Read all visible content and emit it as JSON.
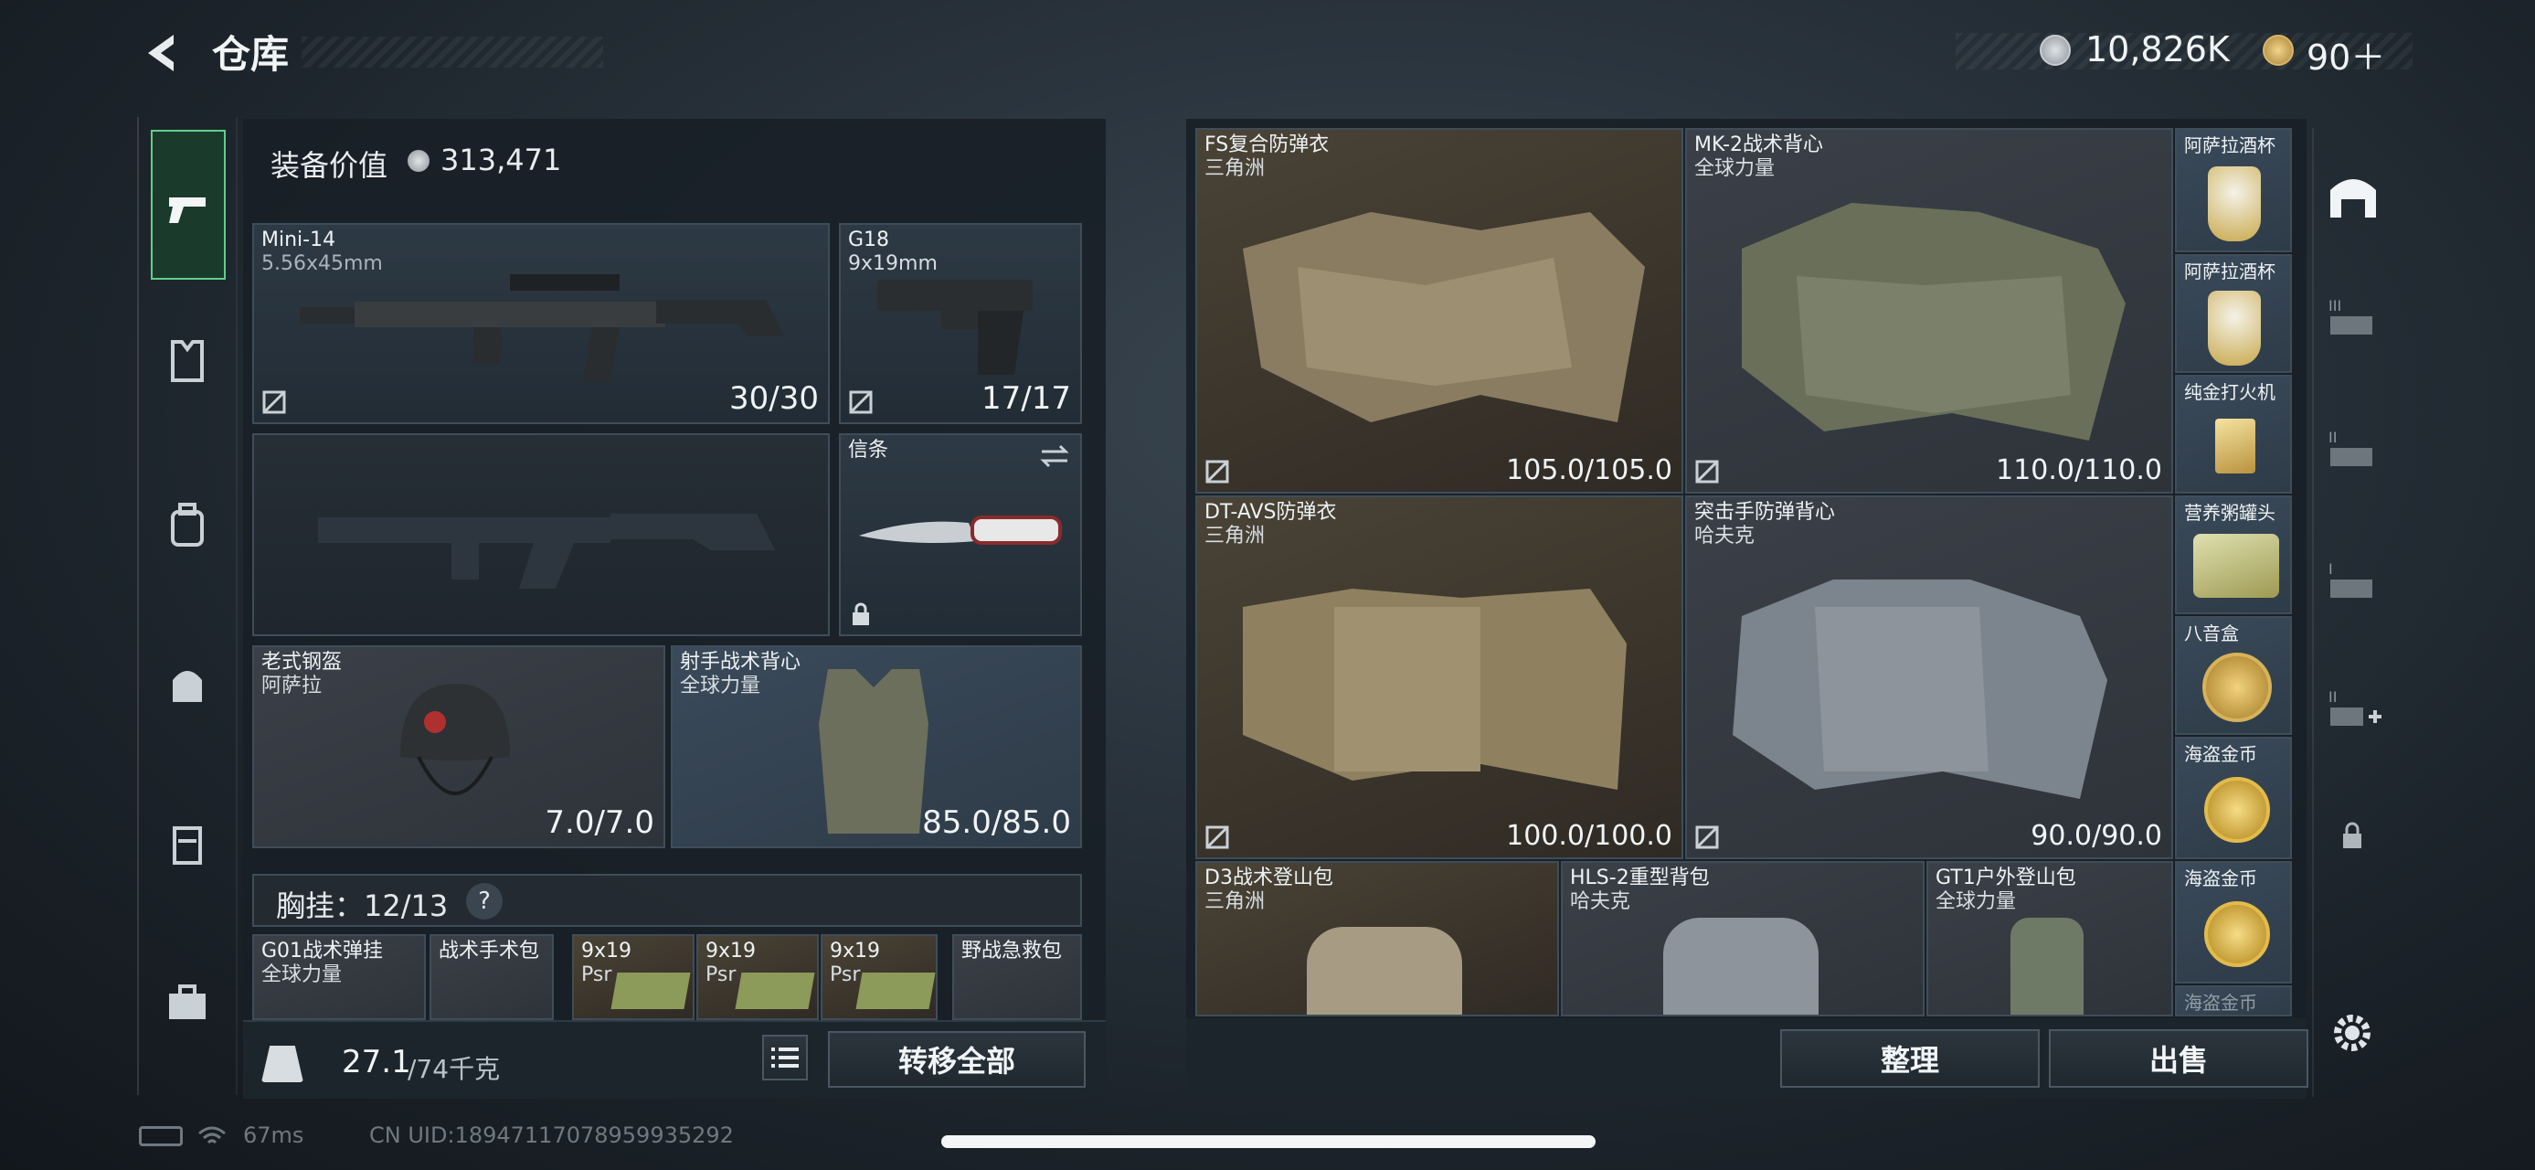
{
  "header": {
    "title": "仓库",
    "currency1": "10,826K",
    "currency2": "90＋"
  },
  "equip_value": {
    "label": "装备价值",
    "value": "313,471"
  },
  "weapons": [
    {
      "name": "Mini-14",
      "ammo": "5.56x45mm",
      "count": "30/30"
    },
    {
      "name": "G18",
      "ammo": "9x19mm",
      "count": "17/17"
    }
  ],
  "melee": {
    "name": "信条"
  },
  "helmet": {
    "name": "老式钢盔",
    "origin": "阿萨拉",
    "durability": "7.0/7.0"
  },
  "vest": {
    "name": "射手战术背心",
    "origin": "全球力量",
    "durability": "85.0/85.0"
  },
  "chest_rig": {
    "label": "胸挂：12/13",
    "help": "?"
  },
  "rig_items": [
    {
      "name": "G01战术弹挂",
      "sub": "全球力量"
    },
    {
      "name": "战术手术包"
    },
    {
      "name": "9x19",
      "sub": "Psr"
    },
    {
      "name": "9x19",
      "sub": "Psr"
    },
    {
      "name": "9x19",
      "sub": "Psr"
    },
    {
      "name": "野战急救包"
    }
  ],
  "weight": {
    "current": "27.1",
    "max": "/74千克",
    "transfer_label": "转移全部"
  },
  "storage_items": [
    {
      "name": "FS复合防弹衣",
      "origin": "三角洲",
      "durability": "105.0/105.0"
    },
    {
      "name": "MK-2战术背心",
      "origin": "全球力量",
      "durability": "110.0/110.0"
    },
    {
      "name": "DT-AVS防弹衣",
      "origin": "三角洲",
      "durability": "100.0/100.0"
    },
    {
      "name": "突击手防弹背心",
      "origin": "哈夫克",
      "durability": "90.0/90.0"
    },
    {
      "name": "D3战术登山包",
      "origin": "三角洲"
    },
    {
      "name": "HLS-2重型背包",
      "origin": "哈夫克"
    },
    {
      "name": "GT1户外登山包",
      "origin": "全球力量"
    }
  ],
  "small_items": [
    {
      "name": "阿萨拉酒杯"
    },
    {
      "name": "阿萨拉酒杯"
    },
    {
      "name": "纯金打火机"
    },
    {
      "name": "营养粥罐头"
    },
    {
      "name": "八音盒"
    },
    {
      "name": "海盗金币"
    },
    {
      "name": "海盗金币"
    },
    {
      "name": "海盗金币"
    }
  ],
  "buttons": {
    "organize": "整理",
    "sell": "出售"
  },
  "status": {
    "ping": "67ms",
    "uid": "CN UID:18947117078959935292"
  },
  "colors": {
    "accent": "#5fd08a",
    "panel": "#1d252c",
    "tan_slot": "#3c362c",
    "blue_slot": "#33414e"
  }
}
